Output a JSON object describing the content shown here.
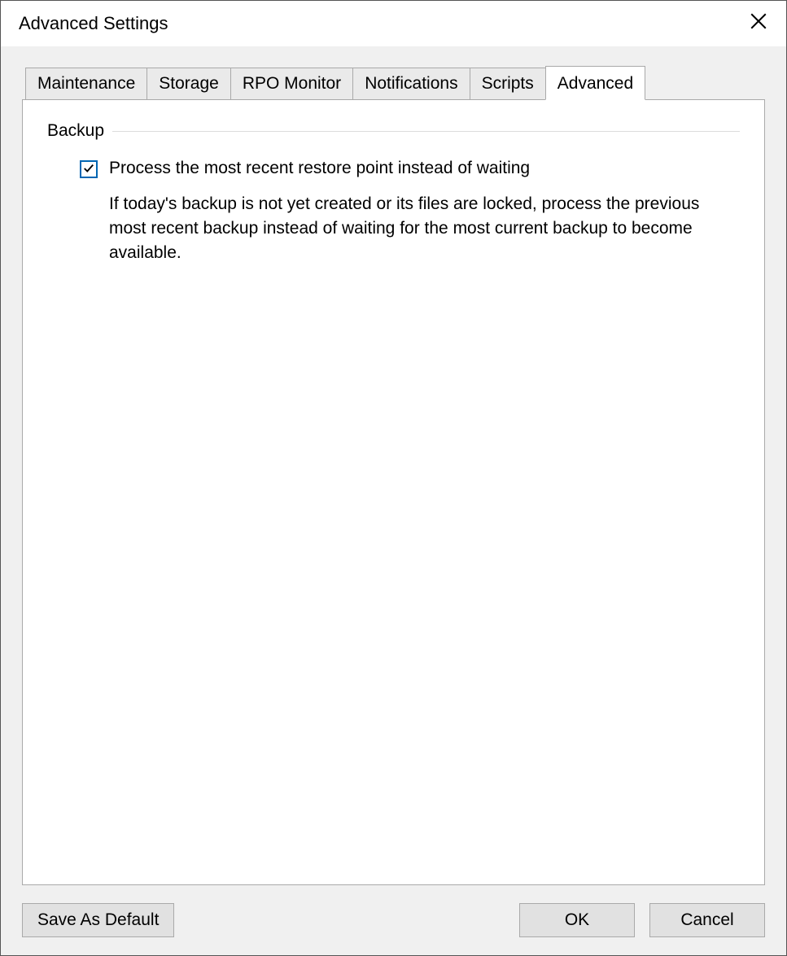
{
  "window": {
    "title": "Advanced Settings"
  },
  "tabs": {
    "maintenance": "Maintenance",
    "storage": "Storage",
    "rpo": "RPO Monitor",
    "notifications": "Notifications",
    "scripts": "Scripts",
    "advanced": "Advanced"
  },
  "backup": {
    "group_title": "Backup",
    "checkbox_checked": true,
    "checkbox_label": "Process the most recent restore point instead of waiting",
    "description": "If today's backup is not yet created or its files are locked, process the previous most recent backup instead of waiting for the most current backup to become available."
  },
  "buttons": {
    "save_default": "Save As Default",
    "ok": "OK",
    "cancel": "Cancel"
  }
}
